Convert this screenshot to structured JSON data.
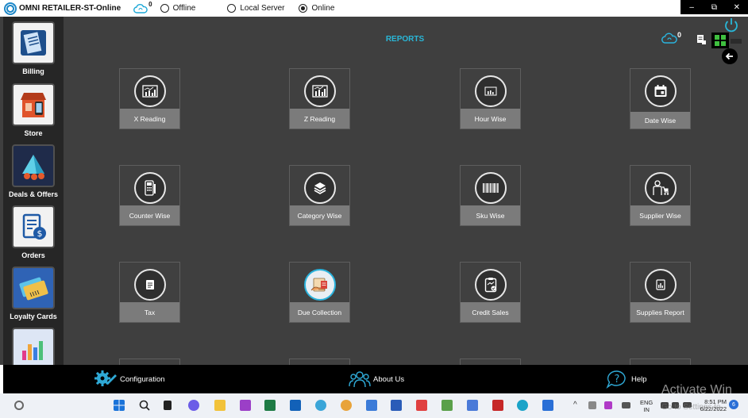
{
  "titlebar": {
    "app_title": "OMNI RETAILER-ST-Online",
    "cloud_count": "0",
    "options": [
      {
        "label": "Offline",
        "checked": false
      },
      {
        "label": "Local Server",
        "checked": false
      },
      {
        "label": "Online",
        "checked": true
      }
    ],
    "window_controls": {
      "minimize": "–",
      "restore": "⧉",
      "close": "✕"
    }
  },
  "header": {
    "title": "REPORTS",
    "cloud_count": "0"
  },
  "sidebar": {
    "items": [
      {
        "label": "Billing",
        "icon": "billing-icon"
      },
      {
        "label": "Store",
        "icon": "store-icon"
      },
      {
        "label": "Deals & Offers",
        "icon": "deals-icon"
      },
      {
        "label": "Orders",
        "icon": "orders-icon"
      },
      {
        "label": "Loyalty Cards",
        "icon": "loyalty-cards-icon"
      },
      {
        "label": "",
        "icon": "reports-chart-icon"
      }
    ]
  },
  "tiles": [
    {
      "label": "X Reading",
      "icon": "chart-icon"
    },
    {
      "label": "Z Reading",
      "icon": "chart-icon"
    },
    {
      "label": "Hour Wise",
      "icon": "chart-icon"
    },
    {
      "label": "Date Wise",
      "icon": "calendar-icon"
    },
    {
      "label": "Counter Wise",
      "icon": "pos-terminal-icon"
    },
    {
      "label": "Category Wise",
      "icon": "layers-icon"
    },
    {
      "label": "Sku Wise",
      "icon": "barcode-icon"
    },
    {
      "label": "Supplier Wise",
      "icon": "supplier-icon"
    },
    {
      "label": "Tax",
      "icon": "receipt-icon"
    },
    {
      "label": "Due Collection",
      "icon": "due-collection-icon"
    },
    {
      "label": "Credit Sales",
      "icon": "clipboard-check-icon"
    },
    {
      "label": "Supplies Report",
      "icon": "report-doc-icon"
    }
  ],
  "footer": {
    "configuration": "Configuration",
    "about": "About Us",
    "help": "Help",
    "help_glyph": "?"
  },
  "taskbar": {
    "lang_line1": "ENG",
    "lang_line2": "IN",
    "time": "8:51 PM",
    "date": "6/22/2022",
    "notifications": "6"
  },
  "watermark": {
    "line1": "Activate Win",
    "line2": "Go to Settings to"
  }
}
